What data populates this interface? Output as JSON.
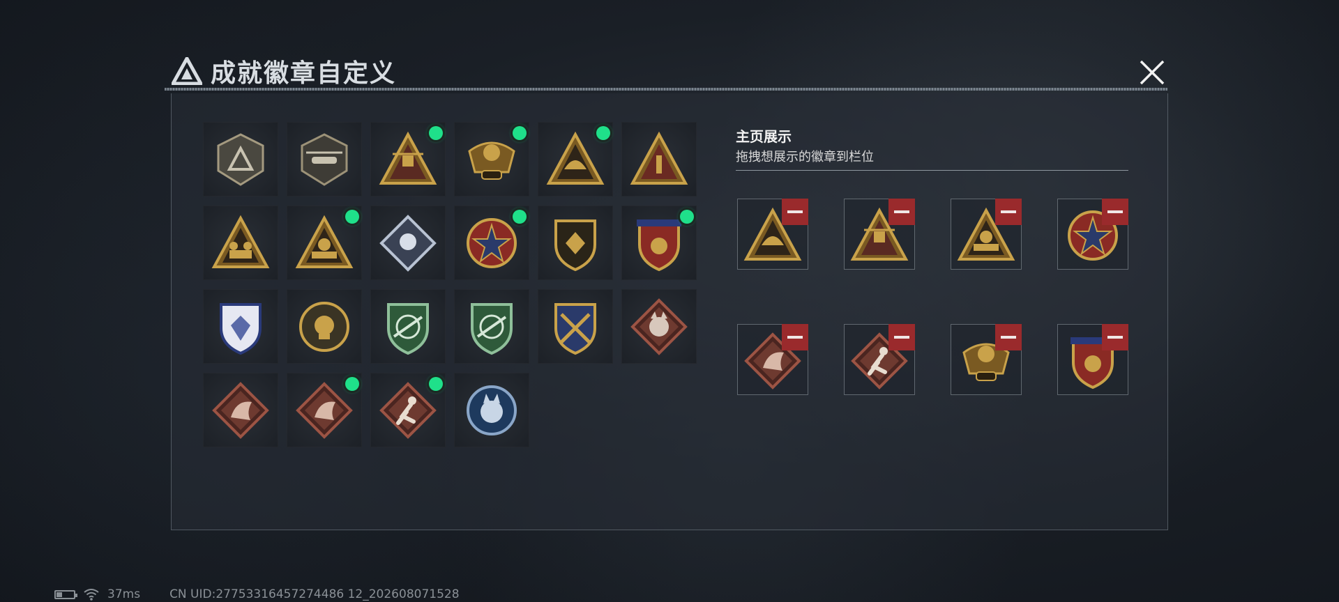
{
  "header": {
    "title": "成就徽章自定义"
  },
  "display_section": {
    "title": "主页展示",
    "subtitle": "拖拽想展示的徽章到栏位"
  },
  "badge_grid": [
    {
      "icon": "triangle-logo-shield-badge",
      "new": false
    },
    {
      "icon": "helicopter-shield-badge",
      "new": false
    },
    {
      "icon": "gold-s9-triangle-badge",
      "new": true
    },
    {
      "icon": "gold-eagle-s18-badge",
      "new": true
    },
    {
      "icon": "gold-dome-triangle-badge",
      "new": true
    },
    {
      "icon": "gold-number-one-triangle-badge",
      "new": false
    },
    {
      "icon": "soldiers-triangle-badge",
      "new": false
    },
    {
      "icon": "beast-soldiers-triangle-badge",
      "new": true
    },
    {
      "icon": "silver-fist-diamond-badge",
      "new": false
    },
    {
      "icon": "star-cross-circle-badge",
      "new": true
    },
    {
      "icon": "gold-emblem-shield-badge",
      "new": false
    },
    {
      "icon": "winged-crest-ribbon-badge",
      "new": true
    },
    {
      "icon": "blue-crystal-shield-badge",
      "new": false
    },
    {
      "icon": "gold-skull-circle-badge",
      "new": false
    },
    {
      "icon": "green-rifle-crosshair-badge",
      "new": false
    },
    {
      "icon": "green-rifle-crosshair-badge-2",
      "new": false
    },
    {
      "icon": "blue-gold-crossed-rifles-badge",
      "new": false
    },
    {
      "icon": "wolf-diamond-badge",
      "new": false
    },
    {
      "icon": "dragon-diamond-badge",
      "new": false
    },
    {
      "icon": "dragon-diamond-badge-2",
      "new": true
    },
    {
      "icon": "runner-diamond-badge",
      "new": true
    },
    {
      "icon": "blue-wolf-circle-badge",
      "new": false
    }
  ],
  "display_slots": [
    {
      "icon": "gold-dome-triangle-badge"
    },
    {
      "icon": "gold-s9-triangle-badge"
    },
    {
      "icon": "beast-soldiers-triangle-badge"
    },
    {
      "icon": "star-cross-circle-badge"
    },
    {
      "icon": "dragon-diamond-badge"
    },
    {
      "icon": "runner-diamond-badge"
    },
    {
      "icon": "gold-eagle-s18-badge"
    },
    {
      "icon": "winged-crest-ribbon-badge"
    }
  ],
  "status_bar": {
    "ping": "37ms",
    "uid": "CN UID:27753316457274486 12_202608071528"
  },
  "colors": {
    "new_dot": "#1fe08a",
    "remove_button": "#9a2a2c",
    "gold": "#c9a24a",
    "copper": "#a0584a"
  }
}
